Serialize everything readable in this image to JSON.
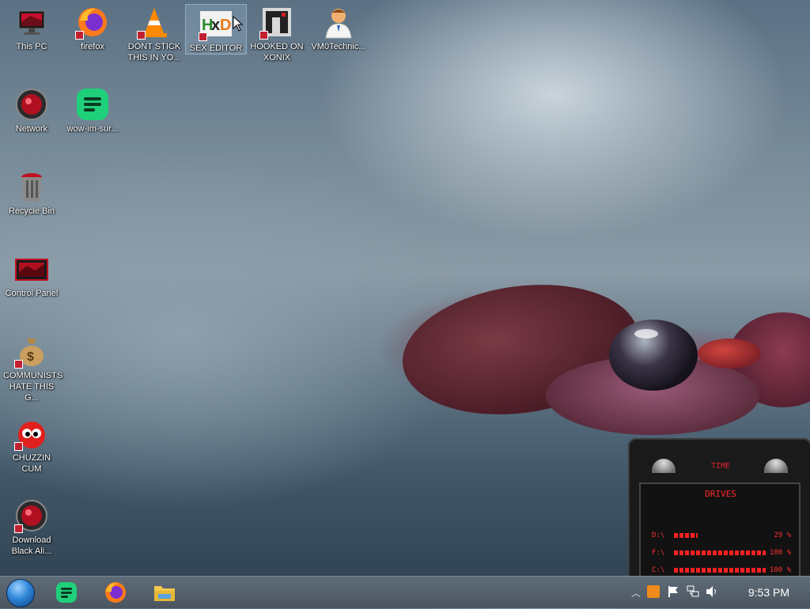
{
  "desktop_icons": [
    {
      "label": "This PC",
      "icon": "computer-icon"
    },
    {
      "label": "firefox",
      "icon": "firefox-icon"
    },
    {
      "label": "DONT STICK THIS IN YO...",
      "icon": "vlc-cone-icon"
    },
    {
      "label": "SEX EDITOR",
      "icon": "hxd-hex-editor-icon"
    },
    {
      "label": "HOOKED ON XONIX",
      "icon": "xonix-game-icon"
    },
    {
      "label": "VM0Technic...",
      "icon": "doctor-person-icon"
    },
    {
      "label": "Network",
      "icon": "network-orb-icon"
    },
    {
      "label": "wow-im-sur...",
      "icon": "document-lines-icon"
    },
    {
      "label": "Recycle Bin",
      "icon": "recycle-bin-icon"
    },
    {
      "label": "Control Panel",
      "icon": "control-panel-icon"
    },
    {
      "label": "COMMUNISTS HATE THIS G...",
      "icon": "money-bag-icon"
    },
    {
      "label": "CHUZZIN CUM",
      "icon": "red-chuzzle-icon"
    },
    {
      "label": "Download Black Ali...",
      "icon": "alienware-orb-icon"
    }
  ],
  "taskbar": {
    "pinned": [
      "start-orb-icon",
      "notes-app-icon",
      "firefox-icon",
      "file-explorer-icon"
    ],
    "tray_icons": [
      "show-hidden-chevron-icon",
      "media-center-icon",
      "action-center-flag-icon",
      "network-icon",
      "volume-icon"
    ],
    "clock": "9:53 PM"
  },
  "gadget": {
    "time_label": "TIME",
    "drives_label": "DRIVES",
    "drives": [
      {
        "letter": "D:\\",
        "percent": "29 %"
      },
      {
        "letter": "F:\\",
        "percent": "100 %"
      },
      {
        "letter": "C:\\",
        "percent": "100 %"
      }
    ]
  },
  "colors": {
    "accent_red": "#e0212b",
    "taskbar": "#4a5560",
    "selection": "#b4d2f0"
  }
}
